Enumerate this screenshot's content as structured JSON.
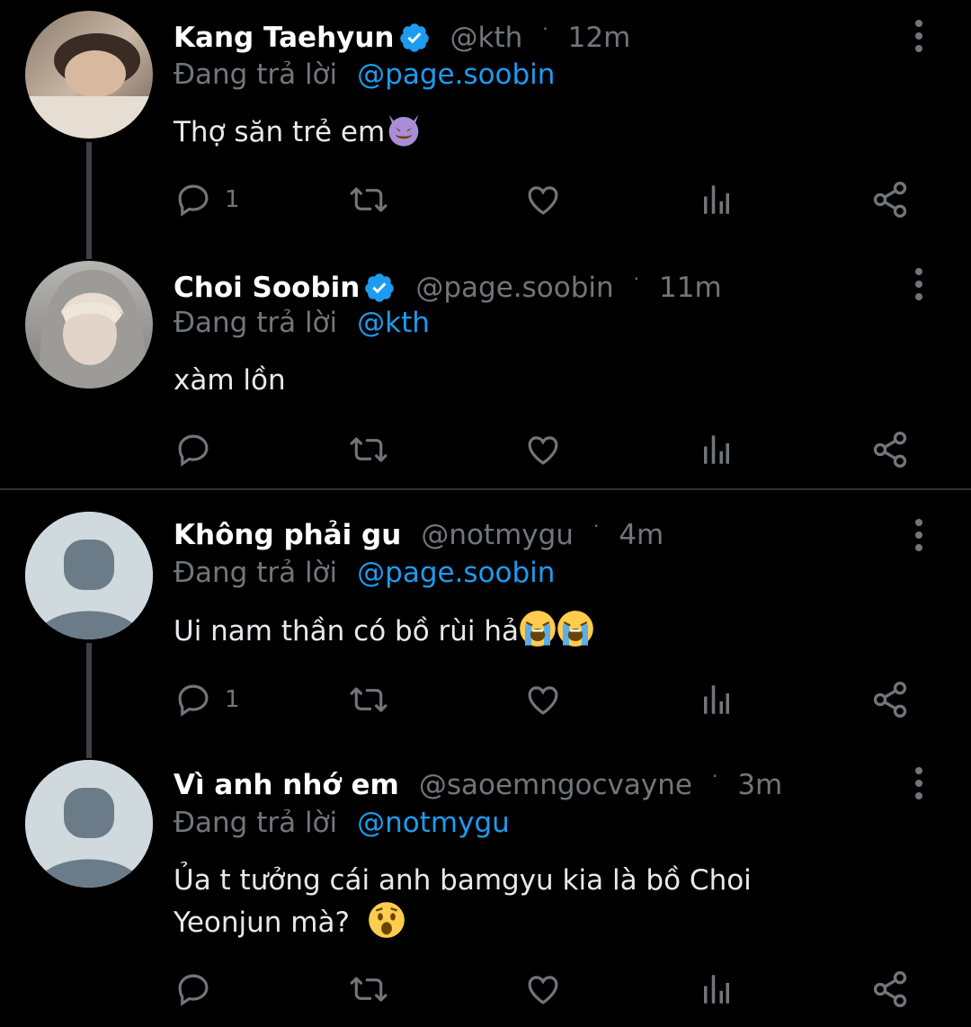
{
  "tweets": [
    {
      "name": "Kang Taehyun",
      "verified": true,
      "handle": "@kth",
      "time": "12m",
      "reply_label": "Đang trả lời",
      "reply_to": "@page.soobin",
      "text": "Thợ săn trẻ em",
      "emoji": [
        "smiling-imp"
      ],
      "reply_count": "1",
      "avatar": "photo"
    },
    {
      "name": "Choi Soobin",
      "verified": true,
      "handle": "@page.soobin",
      "time": "11m",
      "reply_label": "Đang trả lời",
      "reply_to": "@kth",
      "text": "xàm lồn",
      "emoji": [],
      "reply_count": "",
      "avatar": "photo"
    },
    {
      "name": "Không phải gu",
      "verified": false,
      "handle": "@notmygu",
      "time": "4m",
      "reply_label": "Đang trả lời",
      "reply_to": "@page.soobin",
      "text": "Ui nam thần có bồ rùi hả",
      "emoji": [
        "loudly-crying",
        "loudly-crying"
      ],
      "reply_count": "1",
      "avatar": "default"
    },
    {
      "name": "Vì anh nhớ em",
      "verified": false,
      "handle": "@saoemngocvayne",
      "time": "3m",
      "reply_label": "Đang trả lời",
      "reply_to": "@notmygu",
      "text_line1": "Ủa t tưởng cái anh bamgyu kia là bồ Choi",
      "text_line2": "Yeonjun mà?",
      "emoji": [
        "hushed-face"
      ],
      "reply_count": "",
      "avatar": "default"
    }
  ],
  "icons": {
    "reply": "reply-icon",
    "retweet": "retweet-icon",
    "like": "heart-icon",
    "views": "views-icon",
    "share": "share-icon",
    "more": "more-vertical-icon",
    "verified": "verified-badge-icon"
  },
  "colors": {
    "background": "#000000",
    "text": "#e7e9ea",
    "muted": "#71767b",
    "link": "#1d9bf0",
    "verified": "#1d9bf0"
  }
}
